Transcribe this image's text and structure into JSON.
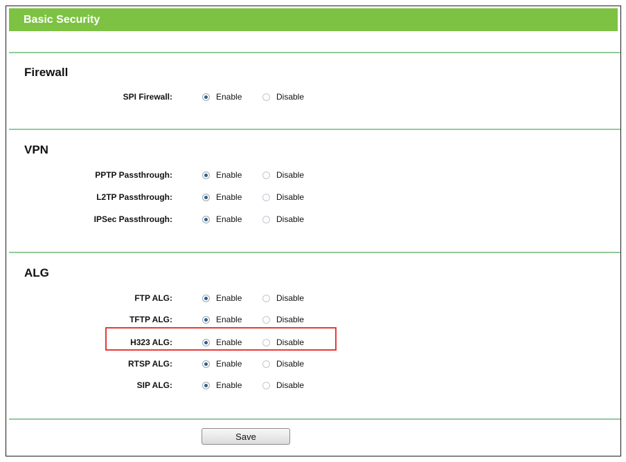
{
  "header": {
    "title": "Basic Security"
  },
  "firewall": {
    "title": "Firewall",
    "rows": [
      {
        "label": "SPI Firewall:",
        "enable": "Enable",
        "disable": "Disable",
        "value": "Enable"
      }
    ]
  },
  "vpn": {
    "title": "VPN",
    "rows": [
      {
        "label": "PPTP Passthrough:",
        "enable": "Enable",
        "disable": "Disable",
        "value": "Enable"
      },
      {
        "label": "L2TP Passthrough:",
        "enable": "Enable",
        "disable": "Disable",
        "value": "Enable"
      },
      {
        "label": "IPSec Passthrough:",
        "enable": "Enable",
        "disable": "Disable",
        "value": "Enable"
      }
    ]
  },
  "alg": {
    "title": "ALG",
    "rows": [
      {
        "label": "FTP ALG:",
        "enable": "Enable",
        "disable": "Disable",
        "value": "Enable"
      },
      {
        "label": "TFTP ALG:",
        "enable": "Enable",
        "disable": "Disable",
        "value": "Enable"
      },
      {
        "label": "H323 ALG:",
        "enable": "Enable",
        "disable": "Disable",
        "value": "Enable"
      },
      {
        "label": "RTSP ALG:",
        "enable": "Enable",
        "disable": "Disable",
        "value": "Enable"
      },
      {
        "label": "SIP ALG:",
        "enable": "Enable",
        "disable": "Disable",
        "value": "Enable"
      }
    ]
  },
  "actions": {
    "save_label": "Save"
  },
  "colors": {
    "header": "#7dc242",
    "separator": "#93c99b",
    "highlight": "#e53a35"
  }
}
